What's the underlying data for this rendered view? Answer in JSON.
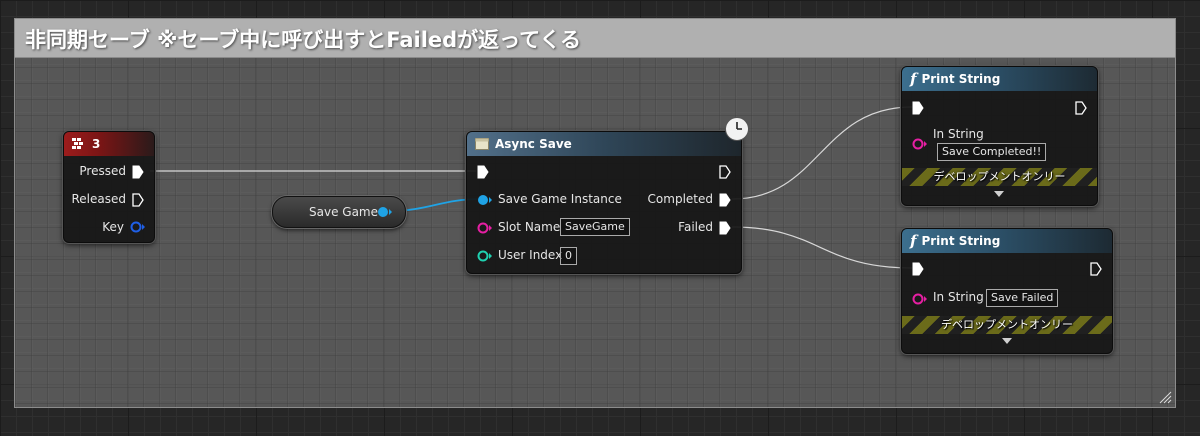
{
  "comment": {
    "title": "非同期セーブ ※セーブ中に呼び出すとFailedが返ってくる"
  },
  "key_event": {
    "title": "3",
    "pins": {
      "pressed": "Pressed",
      "released": "Released",
      "key": "Key"
    },
    "header_color": "#9c1c1c"
  },
  "save_game_var": {
    "label": "Save Game"
  },
  "async_save": {
    "title": "Async Save",
    "inputs": {
      "save_game_instance": "Save Game Instance",
      "slot_name": "Slot Name",
      "slot_name_value": "SaveGame",
      "user_index": "User Index",
      "user_index_value": "0"
    },
    "outputs": {
      "completed": "Completed",
      "failed": "Failed"
    }
  },
  "print_completed": {
    "title": "Print String",
    "in_string_label": "In String",
    "in_string_value": "Save Completed!!",
    "dev_only": "デベロップメントオンリー"
  },
  "print_failed": {
    "title": "Print String",
    "in_string_label": "In String",
    "in_string_value": "Save Failed",
    "dev_only": "デベロップメントオンリー"
  },
  "colors": {
    "object_pin": "#1fa3e6",
    "string_pin": "#e61fa3",
    "integer_pin": "#1fd1b0",
    "struct_pin": "#1f5fe6",
    "exec_pin": "#ffffff"
  }
}
